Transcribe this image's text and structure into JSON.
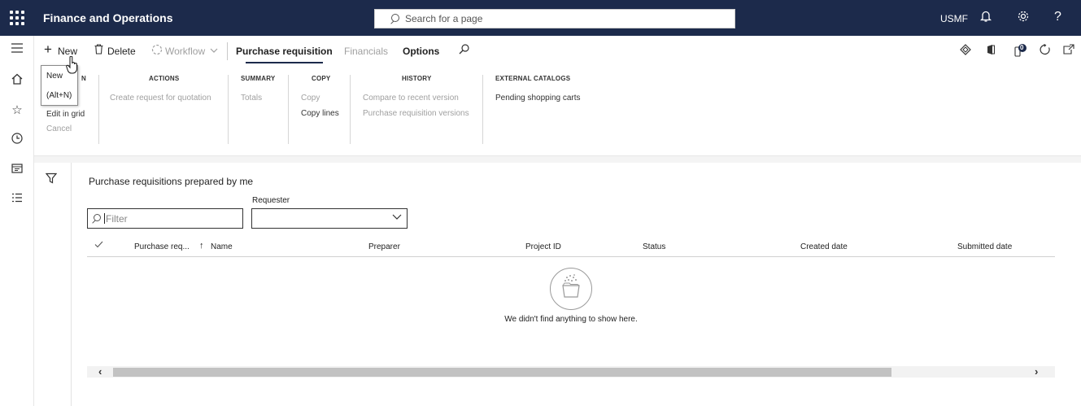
{
  "app": {
    "title": "Finance and Operations"
  },
  "search": {
    "placeholder": "Search for a page"
  },
  "company": "USMF",
  "action_bar": {
    "new": "New",
    "delete": "Delete",
    "workflow": "Workflow",
    "tabs": [
      "Purchase requisition",
      "Financials",
      "Options"
    ]
  },
  "tooltip": {
    "label": "New",
    "shortcut": "(Alt+N)"
  },
  "ribbon": {
    "groups": [
      {
        "title": "N",
        "items": [
          "Edit in grid",
          "Cancel"
        ]
      },
      {
        "title": "ACTIONS",
        "items": [
          "Create request for quotation"
        ]
      },
      {
        "title": "SUMMARY",
        "items": [
          "Totals"
        ]
      },
      {
        "title": "COPY",
        "items": [
          "Copy",
          "Copy lines"
        ]
      },
      {
        "title": "HISTORY",
        "items": [
          "Compare to recent version",
          "Purchase requisition versions"
        ]
      },
      {
        "title": "EXTERNAL CATALOGS",
        "items": [
          "Pending shopping carts"
        ]
      }
    ]
  },
  "view": {
    "title": "Purchase requisitions prepared by me",
    "filter_placeholder": "Filter",
    "requester_label": "Requester",
    "requester_value": ""
  },
  "grid": {
    "columns": [
      "Purchase req...",
      "Name",
      "Preparer",
      "Project ID",
      "Status",
      "Created date",
      "Submitted date"
    ],
    "sort_indicator": "↑",
    "empty_message": "We didn't find anything to show here."
  },
  "badge_count": "0",
  "icons": {
    "waffle": "waffle-icon",
    "bell": "bell-icon",
    "settings": "gear-icon",
    "help": "help-icon",
    "hamburger": "hamburger-icon",
    "home": "home-icon",
    "star": "star-icon",
    "recent": "clock-icon",
    "workspaces": "workspace-icon",
    "modules": "list-icon"
  },
  "colors": {
    "navbar": "#1c2a4b",
    "accent": "#1c2a4b"
  }
}
